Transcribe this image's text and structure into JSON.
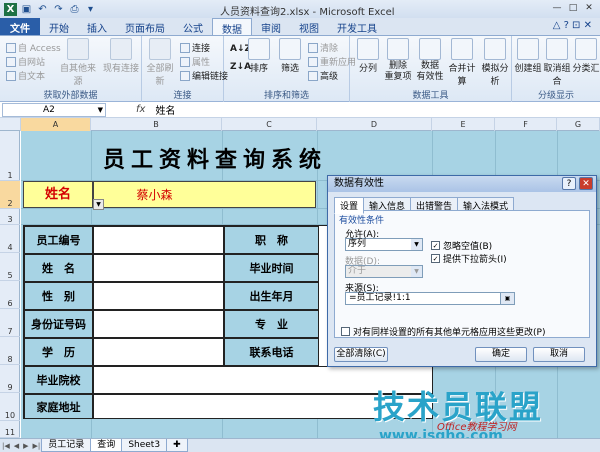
{
  "window": {
    "title": "人员资料查询2.xlsx - Microsoft Excel"
  },
  "ribbon_tabs": [
    "文件",
    "开始",
    "插入",
    "页面布局",
    "公式",
    "数据",
    "审阅",
    "视图",
    "开发工具"
  ],
  "ribbon": {
    "groups": {
      "external": {
        "label": "获取外部数据",
        "cmds": [
          "自 Access",
          "自网站",
          "自文本",
          "自其他来源",
          "现有连接"
        ]
      },
      "connections": {
        "label": "连接",
        "cmds": [
          "全部刷新",
          "连接",
          "属性",
          "编辑链接"
        ]
      },
      "sort": {
        "label": "排序和筛选",
        "cmds": [
          "排序",
          "筛选",
          "清除",
          "重新应用",
          "高级"
        ]
      },
      "tools": {
        "label": "数据工具",
        "cmds": [
          "分列",
          "删除\n重复项",
          "数据\n有效性",
          "合并计算",
          "模拟分析"
        ]
      },
      "outline": {
        "label": "分级显示",
        "cmds": [
          "创建组",
          "取消组合",
          "分类汇"
        ]
      }
    }
  },
  "formula_bar": {
    "name_box": "A2",
    "fx": "fx",
    "content": "姓名"
  },
  "columns": [
    "A",
    "B",
    "C",
    "D",
    "E",
    "F",
    "G"
  ],
  "rows": [
    "1",
    "2",
    "3",
    "4",
    "5",
    "6",
    "7",
    "8",
    "9",
    "10",
    "11"
  ],
  "sheet": {
    "title": "员工资料查询系统",
    "name_label": "姓名",
    "name_value": "蔡小森",
    "form_labels_left": [
      "员工编号",
      "姓　名",
      "性　别",
      "身份证号码",
      "学　历",
      "毕业院校",
      "家庭地址"
    ],
    "form_labels_right": [
      "职　称",
      "毕业时间",
      "出生年月",
      "专　业",
      "联系电话"
    ]
  },
  "sheet_tabs": [
    "员工记录",
    "查询",
    "Sheet3"
  ],
  "dialog": {
    "title": "数据有效性",
    "tabs": [
      "设置",
      "输入信息",
      "出错警告",
      "输入法模式"
    ],
    "section": "有效性条件",
    "allow_label": "允许(A):",
    "allow_value": "序列",
    "data_label": "数据(D):",
    "data_value": "介于",
    "ignore_blank": "忽略空值(B)",
    "dropdown": "提供下拉箭头(I)",
    "source_label": "来源(S):",
    "source_value": "=员工记录!1:1",
    "apply_all": "对有同样设置的所有其他单元格应用这些更改(P)",
    "clear_btn": "全部清除(C)",
    "ok_btn": "确定",
    "cancel_btn": "取消"
  },
  "watermark": {
    "main": "技术员联盟",
    "sub": "Office教程学习网",
    "url": "www.jsgho.com"
  }
}
